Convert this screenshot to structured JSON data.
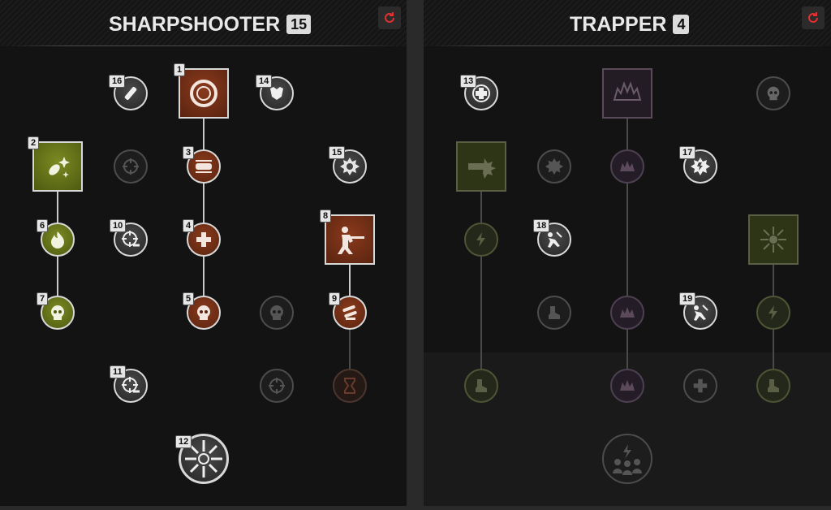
{
  "left_panel": {
    "title": "SHARPSHOOTER",
    "points": "15",
    "reset_icon": "refresh-icon",
    "nodes": [
      {
        "label": "1",
        "icon": "reticle-ring-icon"
      },
      {
        "label": "2",
        "icon": "comet-sparkle-icon"
      },
      {
        "label": "3",
        "icon": "bullet-icon"
      },
      {
        "label": "4",
        "icon": "medic-cross-icon"
      },
      {
        "label": "5",
        "icon": "skull-mushroom-icon"
      },
      {
        "label": "6",
        "icon": "flame-icon"
      },
      {
        "label": "7",
        "icon": "skull-hourglass-icon"
      },
      {
        "label": "8",
        "icon": "prone-shooter-icon"
      },
      {
        "label": "9",
        "icon": "bullets-icon"
      },
      {
        "label": "10",
        "icon": "crosshair-arrow-icon"
      },
      {
        "label": "11",
        "icon": "crosshair-arrow-icon"
      },
      {
        "label": "12",
        "icon": "scope-burst-icon"
      },
      {
        "label": "14",
        "icon": "armor-icon"
      },
      {
        "label": "15",
        "icon": "target-burst-icon"
      },
      {
        "label": "16",
        "icon": "syringe-icon"
      }
    ]
  },
  "right_panel": {
    "title": "TRAPPER",
    "points": "4",
    "reset_icon": "refresh-icon",
    "nodes": [
      {
        "label": "13",
        "icon": "medkit-cross-icon"
      },
      {
        "label": "17",
        "icon": "explosion-icon"
      },
      {
        "label": "18",
        "icon": "crawling-figure-icon"
      },
      {
        "label": "19",
        "icon": "crawling-figure-icon"
      }
    ]
  }
}
